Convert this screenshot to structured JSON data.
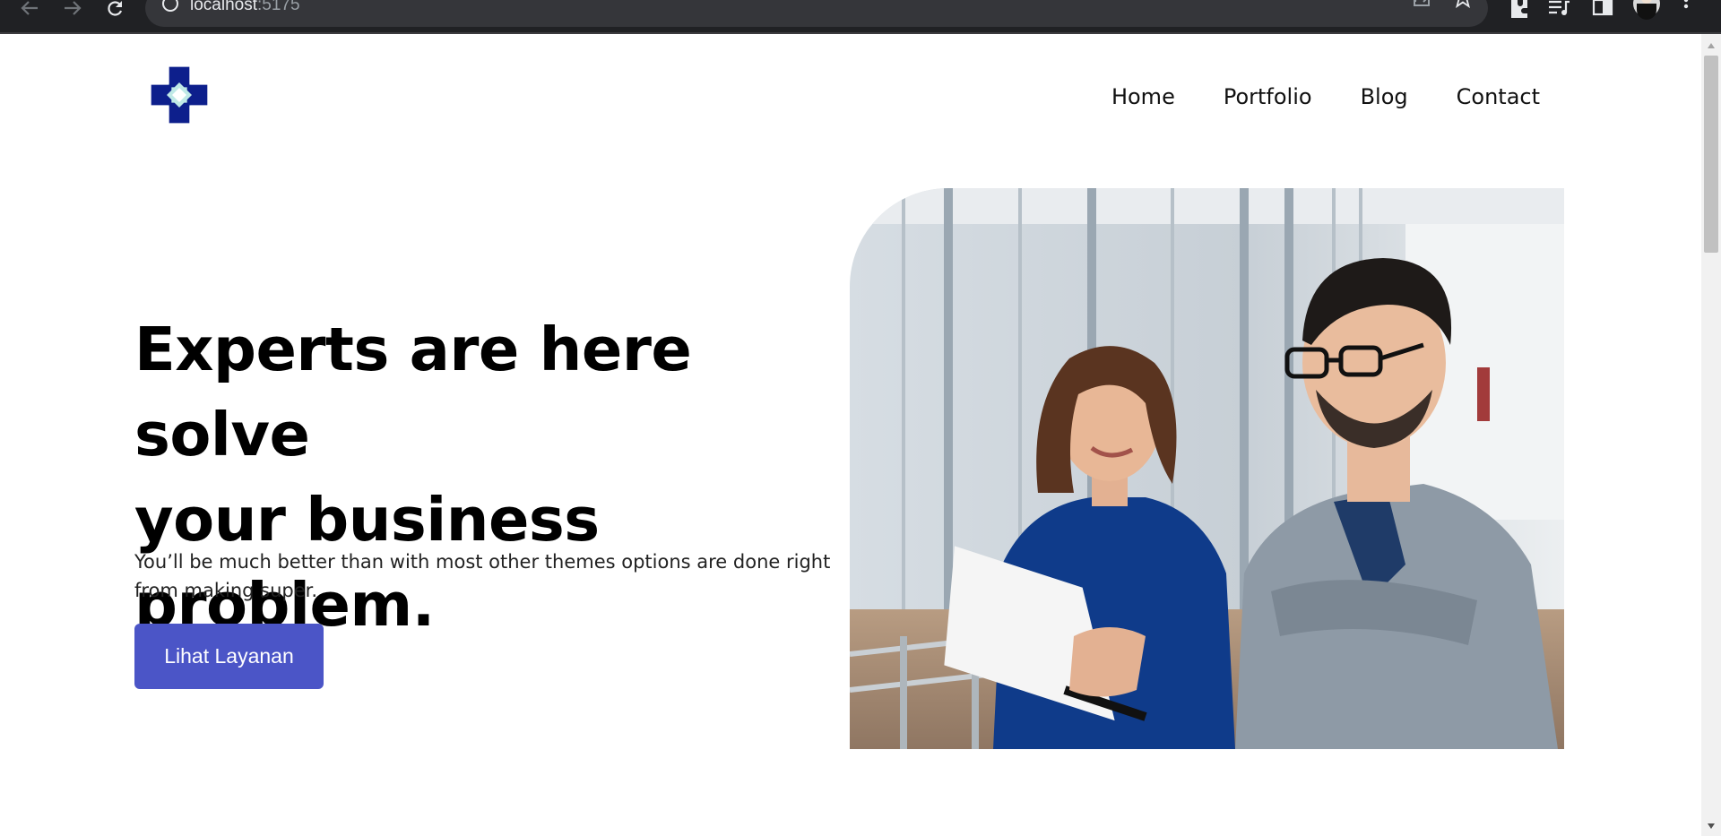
{
  "browser": {
    "url_host": "localhost",
    "url_port": ":5175"
  },
  "nav": {
    "items": [
      {
        "label": "Home"
      },
      {
        "label": "Portfolio"
      },
      {
        "label": "Blog"
      },
      {
        "label": "Contact"
      }
    ]
  },
  "hero": {
    "title_line1": "Experts are here solve",
    "title_line2": "your business problem.",
    "description": "You’ll be much better than with most other themes options are done right from making super.",
    "cta_label": "Lihat Layanan"
  },
  "colors": {
    "brand_primary": "#4b55c7",
    "logo_dark": "#0d1f8c",
    "logo_light": "#bfe9e6",
    "chrome_bg": "#202124"
  }
}
